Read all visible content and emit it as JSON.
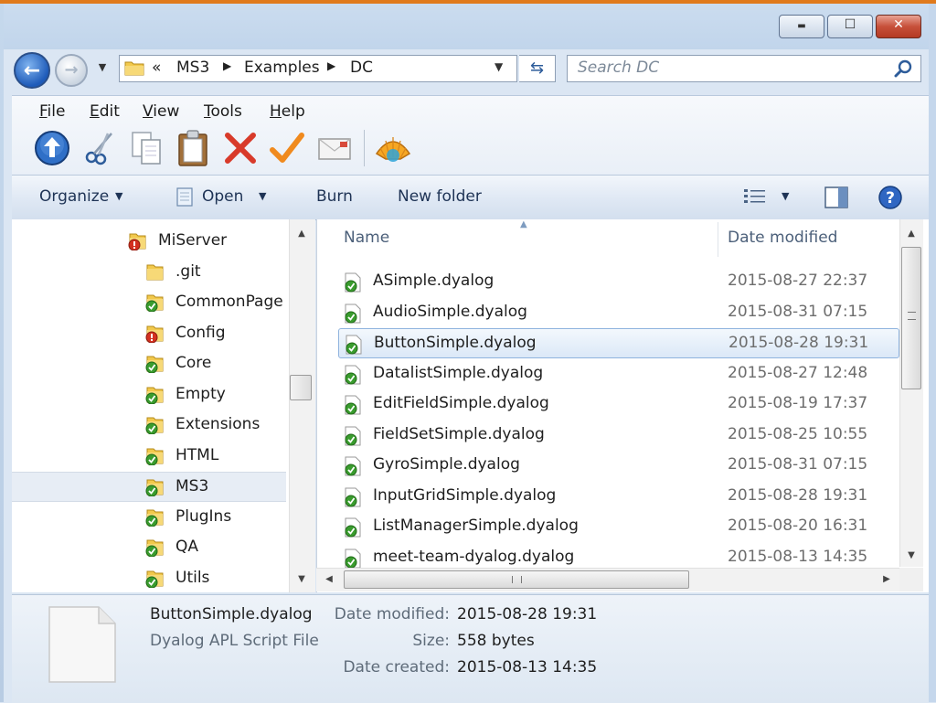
{
  "window": {
    "caption_buttons": {
      "minimize": "▬",
      "maximize": "☐",
      "close": "✕"
    }
  },
  "navigation": {
    "breadcrumb_prefix": "«",
    "breadcrumbs": [
      "MS3",
      "Examples",
      "DC"
    ],
    "search_placeholder": "Search DC"
  },
  "menu": {
    "items": [
      {
        "accel": "F",
        "rest": "ile"
      },
      {
        "accel": "E",
        "rest": "dit"
      },
      {
        "accel": "V",
        "rest": "iew"
      },
      {
        "accel": "T",
        "rest": "ools"
      },
      {
        "accel": "H",
        "rest": "elp"
      }
    ]
  },
  "toolbar": {
    "icons": [
      "up-folder-icon",
      "cut-icon",
      "copy-icon",
      "paste-icon",
      "delete-icon",
      "checkmark-icon",
      "email-icon",
      "shell-icon"
    ]
  },
  "command_bar": {
    "organize": "Organize",
    "open": "Open",
    "burn": "Burn",
    "new_folder": "New folder"
  },
  "tree": {
    "items": [
      {
        "label": "MiServer",
        "icon": "folder-error-icon",
        "indent": 1
      },
      {
        "label": ".git",
        "icon": "folder-icon",
        "indent": 2
      },
      {
        "label": "CommonPage",
        "icon": "folder-ok-icon",
        "indent": 2
      },
      {
        "label": "Config",
        "icon": "folder-error-icon",
        "indent": 2
      },
      {
        "label": "Core",
        "icon": "folder-ok-icon",
        "indent": 2
      },
      {
        "label": "Empty",
        "icon": "folder-ok-icon",
        "indent": 2
      },
      {
        "label": "Extensions",
        "icon": "folder-ok-icon",
        "indent": 2
      },
      {
        "label": "HTML",
        "icon": "folder-ok-icon",
        "indent": 2
      },
      {
        "label": "MS3",
        "icon": "folder-ok-icon",
        "indent": 2,
        "selected": true
      },
      {
        "label": "PlugIns",
        "icon": "folder-ok-icon",
        "indent": 2
      },
      {
        "label": "QA",
        "icon": "folder-ok-icon",
        "indent": 2
      },
      {
        "label": "Utils",
        "icon": "folder-ok-icon",
        "indent": 2
      }
    ]
  },
  "file_list": {
    "columns": {
      "name": "Name",
      "date": "Date modified"
    },
    "files": [
      {
        "name": "ASimple.dyalog",
        "date": "2015-08-27 22:37"
      },
      {
        "name": "AudioSimple.dyalog",
        "date": "2015-08-31 07:15"
      },
      {
        "name": "ButtonSimple.dyalog",
        "date": "2015-08-28 19:31",
        "selected": true
      },
      {
        "name": "DatalistSimple.dyalog",
        "date": "2015-08-27 12:48"
      },
      {
        "name": "EditFieldSimple.dyalog",
        "date": "2015-08-19 17:37"
      },
      {
        "name": "FieldSetSimple.dyalog",
        "date": "2015-08-25 10:55"
      },
      {
        "name": "GyroSimple.dyalog",
        "date": "2015-08-31 07:15"
      },
      {
        "name": "InputGridSimple.dyalog",
        "date": "2015-08-28 19:31"
      },
      {
        "name": "ListManagerSimple.dyalog",
        "date": "2015-08-20 16:31"
      },
      {
        "name": "meet-team-dyalog.dyalog",
        "date": "2015-08-13 14:35"
      }
    ]
  },
  "details": {
    "filename": "ButtonSimple.dyalog",
    "filetype": "Dyalog APL Script File",
    "date_modified_label": "Date modified:",
    "date_modified": "2015-08-28 19:31",
    "size_label": "Size:",
    "size": "558 bytes",
    "date_created_label": "Date created:",
    "date_created": "2015-08-13 14:35"
  }
}
